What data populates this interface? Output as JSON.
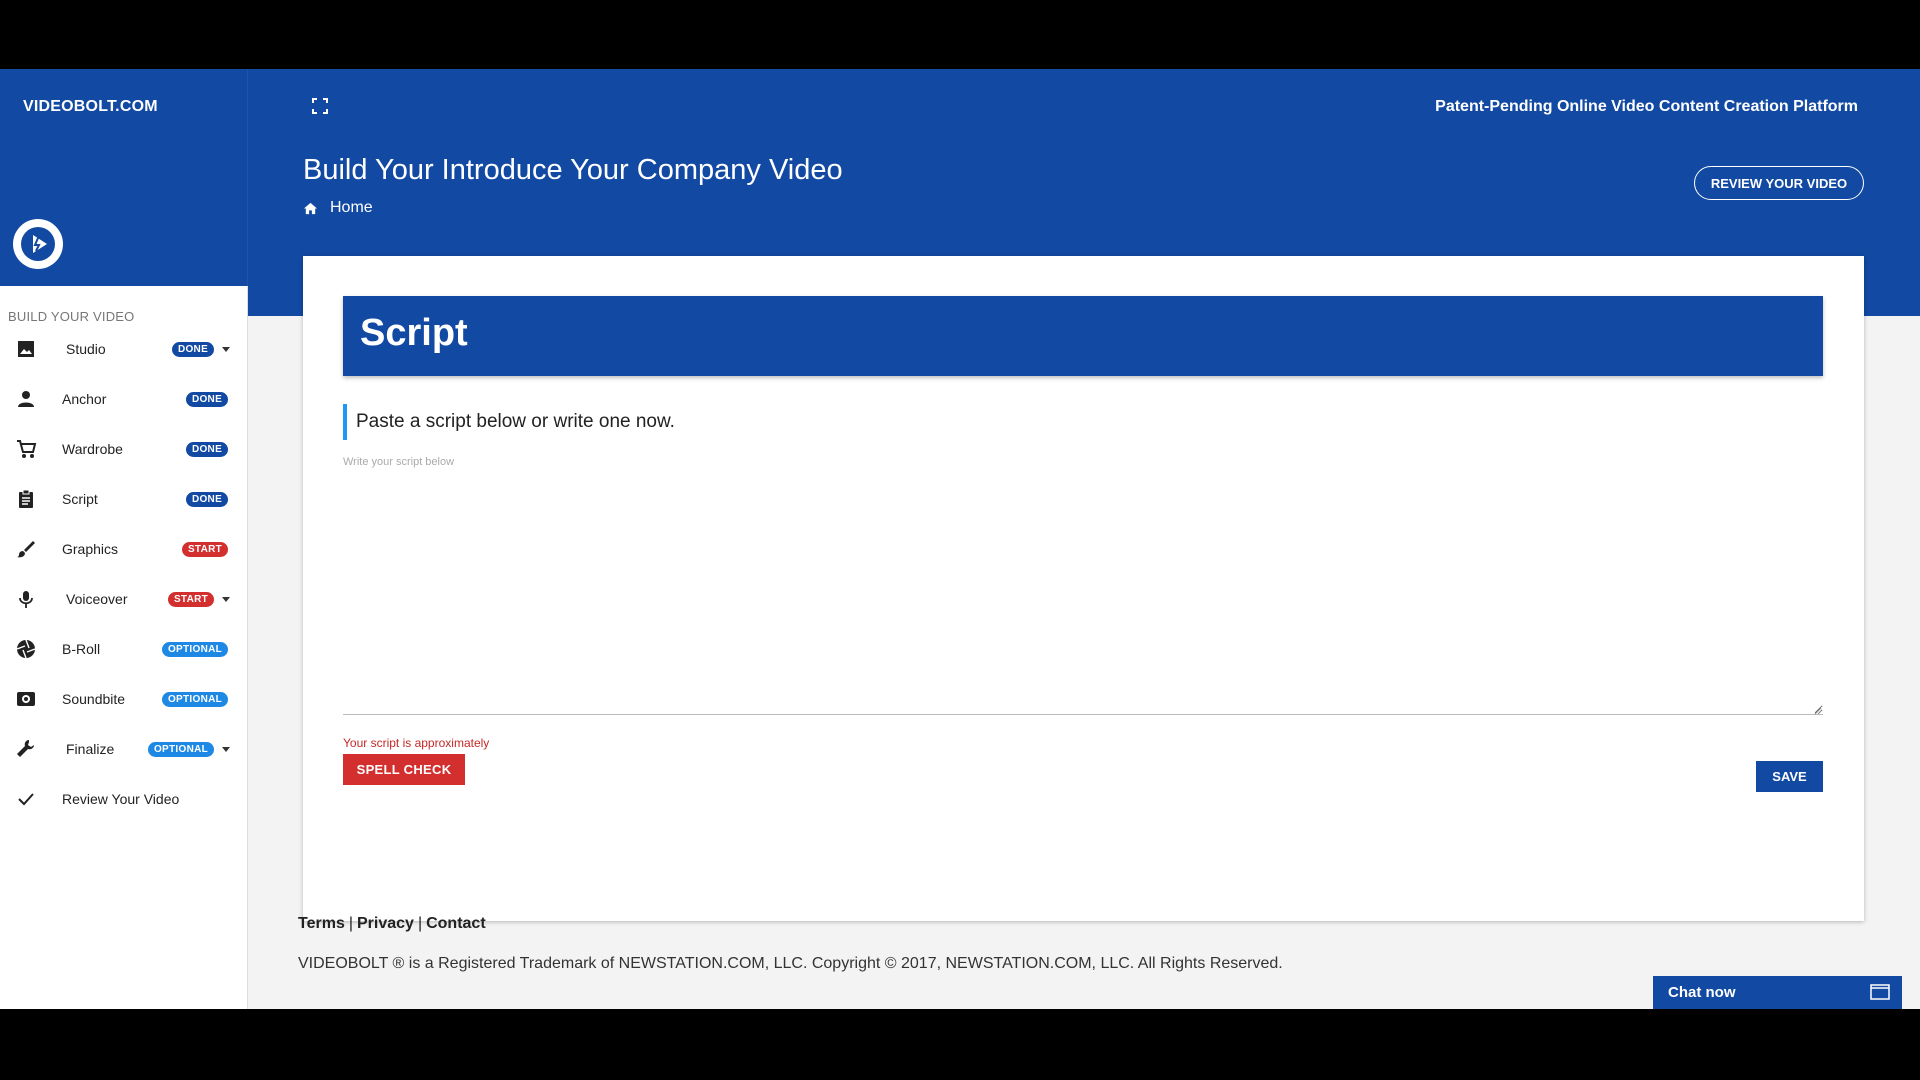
{
  "brand": "VIDEOBOLT.COM",
  "tagline": "Patent-Pending Online Video Content Creation Platform",
  "page_title": "Build Your Introduce Your Company Video",
  "breadcrumb": {
    "home": "Home"
  },
  "review_button": "REVIEW YOUR VIDEO",
  "sidebar": {
    "heading": "BUILD YOUR VIDEO",
    "items": [
      {
        "label": "Studio",
        "icon": "image-icon",
        "badge": "DONE",
        "badge_color": "#1249a3",
        "has_caret": true
      },
      {
        "label": "Anchor",
        "icon": "person-icon",
        "badge": "DONE",
        "badge_color": "#1249a3",
        "has_caret": false
      },
      {
        "label": "Wardrobe",
        "icon": "cart-icon",
        "badge": "DONE",
        "badge_color": "#1249a3",
        "has_caret": false
      },
      {
        "label": "Script",
        "icon": "clipboard-icon",
        "badge": "DONE",
        "badge_color": "#1249a3",
        "has_caret": false
      },
      {
        "label": "Graphics",
        "icon": "brush-icon",
        "badge": "START",
        "badge_color": "#d32f2f",
        "has_caret": false
      },
      {
        "label": "Voiceover",
        "icon": "microphone-icon",
        "badge": "START",
        "badge_color": "#d32f2f",
        "has_caret": true
      },
      {
        "label": "B-Roll",
        "icon": "camera-aperture-icon",
        "badge": "OPTIONAL",
        "badge_color": "#1e88e5",
        "has_caret": false
      },
      {
        "label": "Soundbite",
        "icon": "speaker-icon",
        "badge": "OPTIONAL",
        "badge_color": "#1e88e5",
        "has_caret": false
      },
      {
        "label": "Finalize",
        "icon": "wrench-icon",
        "badge": "OPTIONAL",
        "badge_color": "#1e88e5",
        "has_caret": true
      },
      {
        "label": "Review Your Video",
        "icon": "check-icon",
        "badge": "",
        "badge_color": "",
        "has_caret": false
      }
    ]
  },
  "card": {
    "title": "Script",
    "instruction": "Paste a script below or write one now.",
    "script_placeholder": "Write your script below",
    "script_value": "",
    "approx_text": "Your script is approximately",
    "spell_check_label": "SPELL CHECK",
    "save_label": "SAVE"
  },
  "footer": {
    "terms": "Terms",
    "privacy": "Privacy",
    "contact": "Contact",
    "copyright": "VIDEOBOLT ® is a Registered Trademark of NEWSTATION.COM, LLC. Copyright © 2017, NEWSTATION.COM, LLC. All Rights Reserved."
  },
  "chat": {
    "label": "Chat now"
  }
}
